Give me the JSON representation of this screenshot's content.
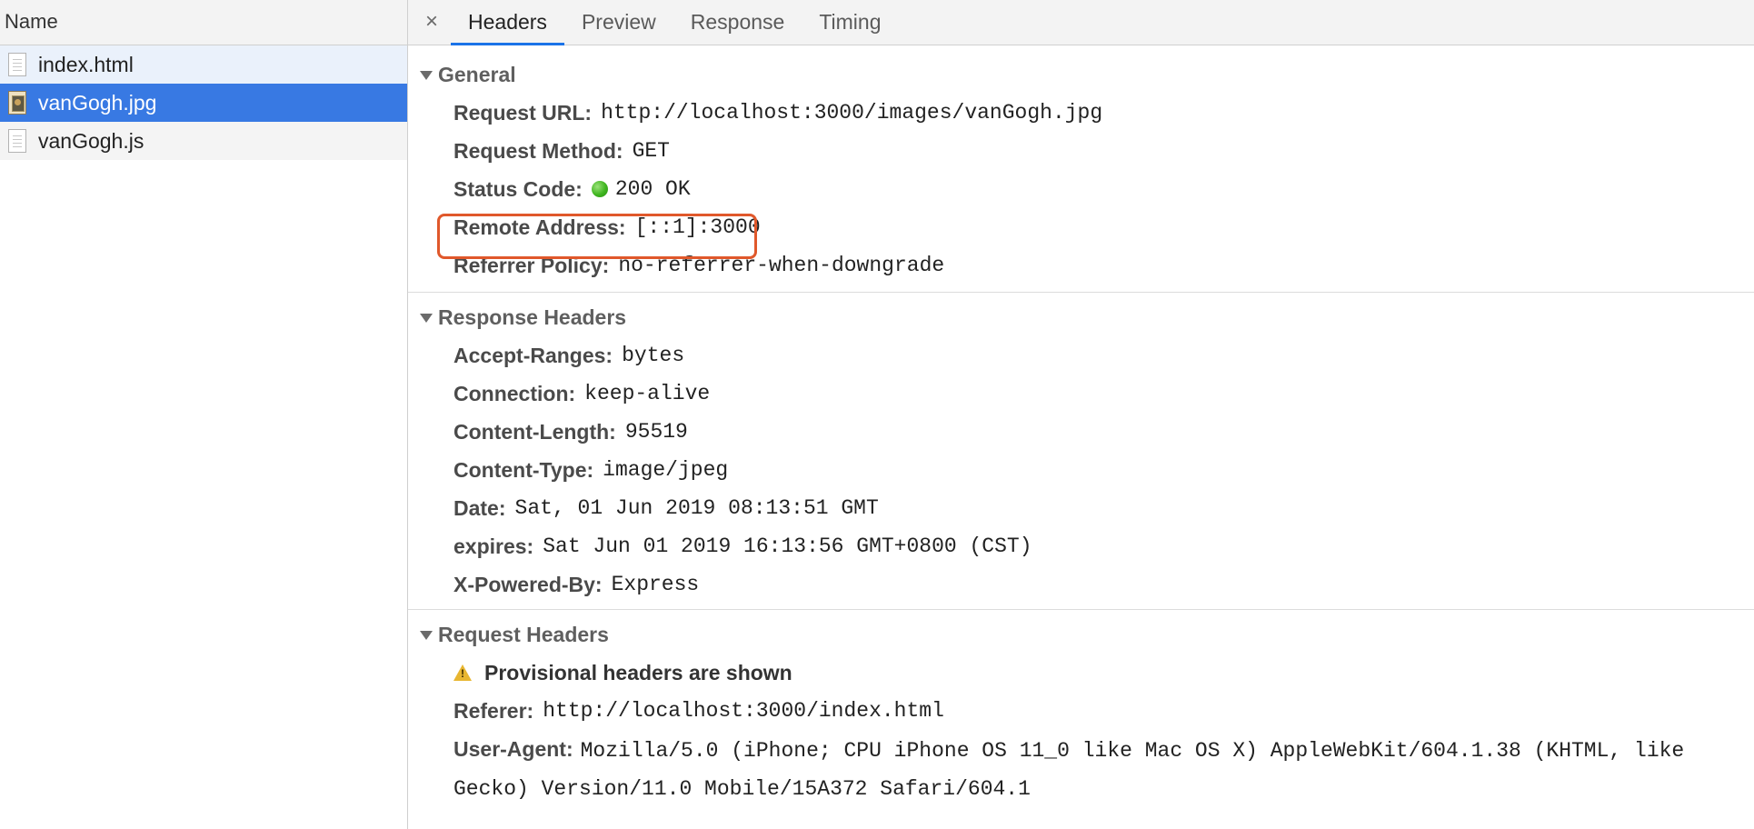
{
  "sidebar": {
    "header": "Name",
    "files": [
      {
        "name": "index.html",
        "icon": "document-icon"
      },
      {
        "name": "vanGogh.jpg",
        "icon": "image-icon",
        "selected": true
      },
      {
        "name": "vanGogh.js",
        "icon": "document-icon"
      }
    ]
  },
  "tabs": {
    "close": "×",
    "items": [
      "Headers",
      "Preview",
      "Response",
      "Timing"
    ],
    "active": "Headers"
  },
  "general": {
    "title": "General",
    "request_url_key": "Request URL:",
    "request_url": "http://localhost:3000/images/vanGogh.jpg",
    "request_method_key": "Request Method:",
    "request_method": "GET",
    "status_code_key": "Status Code:",
    "status_code": "200 OK",
    "status_color": "#3fb51f",
    "remote_address_key": "Remote Address:",
    "remote_address": "[::1]:3000",
    "referrer_policy_key": "Referrer Policy:",
    "referrer_policy": "no-referrer-when-downgrade"
  },
  "response_headers": {
    "title": "Response Headers",
    "rows": [
      {
        "key": "Accept-Ranges:",
        "value": "bytes"
      },
      {
        "key": "Connection:",
        "value": "keep-alive"
      },
      {
        "key": "Content-Length:",
        "value": "95519"
      },
      {
        "key": "Content-Type:",
        "value": "image/jpeg"
      },
      {
        "key": "Date:",
        "value": "Sat, 01 Jun 2019 08:13:51 GMT"
      },
      {
        "key": "expires:",
        "value": "Sat Jun 01 2019 16:13:56 GMT+0800 (CST)"
      },
      {
        "key": "X-Powered-By:",
        "value": "Express"
      }
    ]
  },
  "request_headers": {
    "title": "Request Headers",
    "warning": "Provisional headers are shown",
    "referer_key": "Referer:",
    "referer": "http://localhost:3000/index.html",
    "user_agent_key": "User-Agent:",
    "user_agent": "Mozilla/5.0 (iPhone; CPU iPhone OS 11_0 like Mac OS X) AppleWebKit/604.1.38 (KHTML, like Gecko) Version/11.0 Mobile/15A372 Safari/604.1"
  },
  "colors": {
    "selected_row": "#3879e3",
    "active_tab_underline": "#1a73e8",
    "highlight_box": "#e0582b",
    "warning_icon": "#e8b630"
  }
}
